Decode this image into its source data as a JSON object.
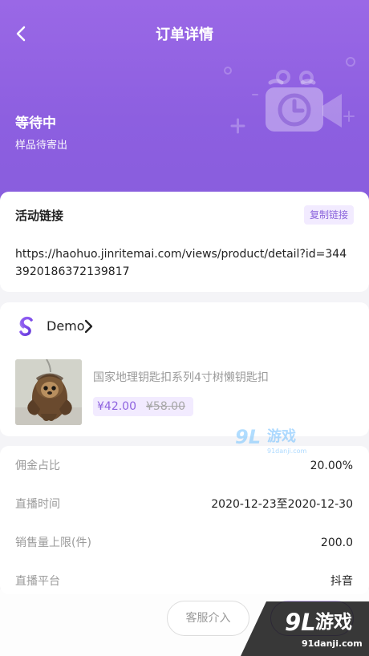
{
  "header": {
    "title": "订单详情",
    "status_title": "等待中",
    "status_subtitle": "样品待寄出"
  },
  "activity_link": {
    "title": "活动链接",
    "copy_label": "复制链接",
    "url": "https://haohuo.jinritemai.com/views/product/detail?id=3443920186372139817"
  },
  "product": {
    "brand_name": "Demo",
    "title": "国家地理钥匙扣系列4寸树懒钥匙扣",
    "price": "¥42.00",
    "original_price": "¥58.00"
  },
  "details": [
    {
      "label": "佣金占比",
      "value": "20.00%"
    },
    {
      "label": "直播时间",
      "value": "2020-12-23至2020-12-30"
    },
    {
      "label": "销售量上限(件)",
      "value": "200.0"
    },
    {
      "label": "直播平台",
      "value": "抖音"
    }
  ],
  "bottom": {
    "service_button": "客服介入"
  },
  "watermarks": {
    "small_symbol": "9L",
    "small_name": "游戏",
    "small_domain": "91danji.com",
    "large_symbol": "9L",
    "large_name": "游戏",
    "large_domain": "91danji.com"
  },
  "icons": [
    "back-icon",
    "video-calendar-illustration",
    "brand-logo",
    "chevron-right-icon"
  ],
  "colors": {
    "primary": "#8f62e0",
    "header": "#965fe3"
  }
}
